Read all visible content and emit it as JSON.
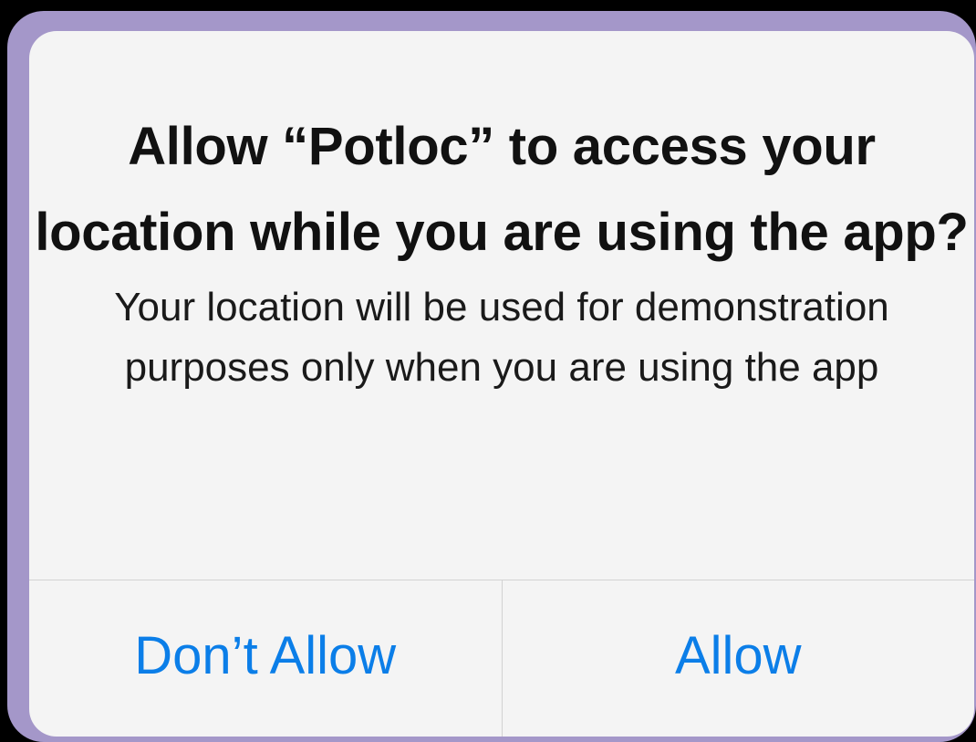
{
  "alert": {
    "title": "Allow “Potloc” to access your location while you are using the app?",
    "message": "Your location will be used for demonstration purposes only when you are using the app",
    "buttons": {
      "dont_allow": "Don’t Allow",
      "allow": "Allow"
    }
  },
  "colors": {
    "background": "#000000",
    "frame": "#a497c9",
    "alert_background": "#f4f4f4",
    "button_text": "#0b7ee8",
    "divider": "#d2d2d2"
  }
}
